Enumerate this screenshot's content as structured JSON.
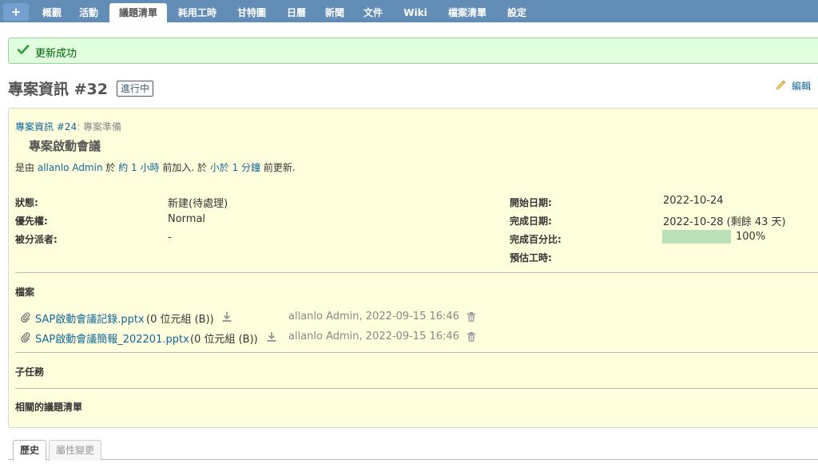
{
  "topmenu": {
    "plus": "+",
    "tabs": [
      "概觀",
      "活動",
      "議題清單",
      "耗用工時",
      "甘特圖",
      "日曆",
      "新聞",
      "文件",
      "Wiki",
      "檔案清單",
      "設定"
    ],
    "active_index": 2
  },
  "flash": {
    "message": "更新成功",
    "icon": "check-icon"
  },
  "issue": {
    "title": "專案資訊 #32",
    "status_tag": "進行中",
    "edit_label": "編輯",
    "parent_link": "專案資訊 #24",
    "parent_suffix": ": 專案準備",
    "subject": "專案啟動會議",
    "author": {
      "prefix": "是由",
      "name": "allanlo Admin",
      "sep1": "於",
      "created": "約 1 小時",
      "mid": "前加入. 於",
      "updated": "小於 1 分鐘",
      "suffix": "前更新."
    },
    "attributes_left": [
      {
        "label": "狀態:",
        "value": "新建(待處理)"
      },
      {
        "label": "優先權:",
        "value": "Normal"
      },
      {
        "label": "被分派者:",
        "value": "-"
      }
    ],
    "attributes_right": [
      {
        "label": "開始日期:",
        "value": "2022-10-24"
      },
      {
        "label": "完成日期:",
        "value": "2022-10-28 (剩餘 43 天)"
      },
      {
        "label": "完成百分比:",
        "value": ""
      },
      {
        "label": "預估工時:",
        "value": ""
      }
    ],
    "done_ratio": 100,
    "done_ratio_label": "100%",
    "files_title": "檔案",
    "attachments": [
      {
        "filename": "SAP啟動會議記錄.pptx",
        "size": "(0 位元組 (B))",
        "meta": "allanlo Admin, 2022-09-15 16:46"
      },
      {
        "filename": "SAP啟動會議簡報_202201.pptx",
        "size": "(0 位元組 (B))",
        "meta": "allanlo Admin, 2022-09-15 16:46"
      }
    ],
    "subtasks_title": "子任務",
    "relations_title": "相關的議題清單"
  },
  "bottom_tabs": {
    "history": "歷史",
    "changes": "屬性變更"
  },
  "colors": {
    "menu_bar": "#628db6",
    "link": "#169",
    "issue_bg": "#ffffdd",
    "progress": "#bae0ba",
    "flash_bg": "#dfffdf"
  }
}
